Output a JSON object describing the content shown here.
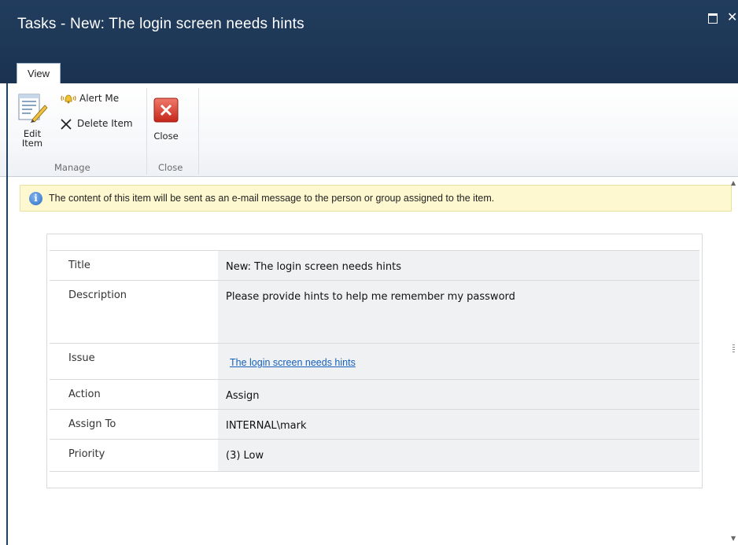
{
  "window": {
    "title": "Tasks - New: The login screen needs hints",
    "maximize_icon": "maximize-icon",
    "close_icon": "close-icon"
  },
  "ribbon": {
    "tab_label": "View",
    "manage_group": {
      "label": "Manage",
      "edit_label_line1": "Edit",
      "edit_label_line2": "Item",
      "alert_label": "Alert Me",
      "delete_label": "Delete Item"
    },
    "close_group": {
      "label": "Close",
      "close_label": "Close"
    }
  },
  "info_message": "The content of this item will be sent as an e-mail message to the person or group assigned to the item.",
  "fields": [
    {
      "label": "Title",
      "value": "New: The login screen needs hints"
    },
    {
      "label": "Description",
      "value": "Please provide hints to help me remember my password"
    },
    {
      "label": "Issue",
      "value": "The login screen needs hints",
      "is_link": true
    },
    {
      "label": "Action",
      "value": "Assign"
    },
    {
      "label": "Assign To",
      "value": "INTERNAL\\mark"
    },
    {
      "label": "Priority",
      "value": "(3) Low"
    }
  ],
  "colors": {
    "titlebar": "#1f3a59",
    "link": "#1560bd",
    "infobar": "#fdf8cf",
    "value_bg": "#f0f1f3"
  }
}
